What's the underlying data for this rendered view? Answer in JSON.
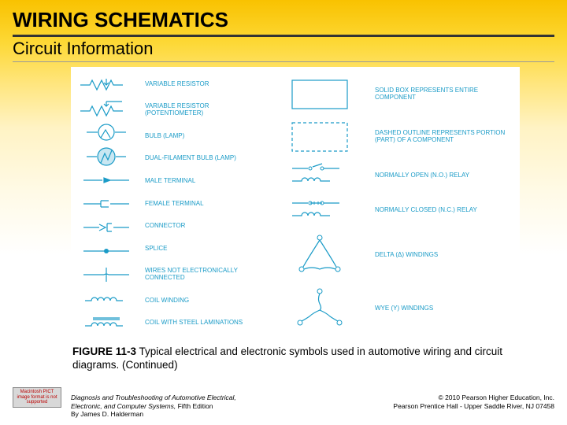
{
  "title": "WIRING SCHEMATICS",
  "subtitle": "Circuit Information",
  "left_labels": [
    "VARIABLE RESISTOR",
    "VARIABLE RESISTOR (POTENTIOMETER)",
    "BULB (LAMP)",
    "DUAL-FILAMENT BULB (LAMP)",
    "MALE TERMINAL",
    "FEMALE TERMINAL",
    "CONNECTOR",
    "SPLICE",
    "WIRES NOT ELECTRONICALLY CONNECTED",
    "COIL WINDING",
    "COIL WITH STEEL LAMINATIONS"
  ],
  "right_labels": [
    "SOLID BOX REPRESENTS ENTIRE COMPONENT",
    "DASHED OUTLINE REPRESENTS PORTION (PART) OF A COMPONENT",
    "NORMALLY OPEN (N.O.) RELAY",
    "NORMALLY CLOSED (N.C.) RELAY",
    "DELTA (Δ) WINDINGS",
    "WYE (Y) WINDINGS"
  ],
  "caption_bold": "FIGURE 11-3",
  "caption_rest": " Typical electrical and electronic symbols used in automotive wiring and circuit diagrams. (Continued)",
  "footer_left_line1": "Diagnosis and Troubleshooting of Automotive Electrical,",
  "footer_left_line2": "Electronic, and Computer Systems,",
  "footer_left_edition": " Fifth Edition",
  "footer_left_line3": "By James D. Halderman",
  "footer_right_line1": "© 2010 Pearson Higher Education, Inc.",
  "footer_right_line2": "Pearson Prentice Hall - Upper Saddle River, NJ 07458",
  "badge_text": "Macintosh PICT image format is not supported"
}
